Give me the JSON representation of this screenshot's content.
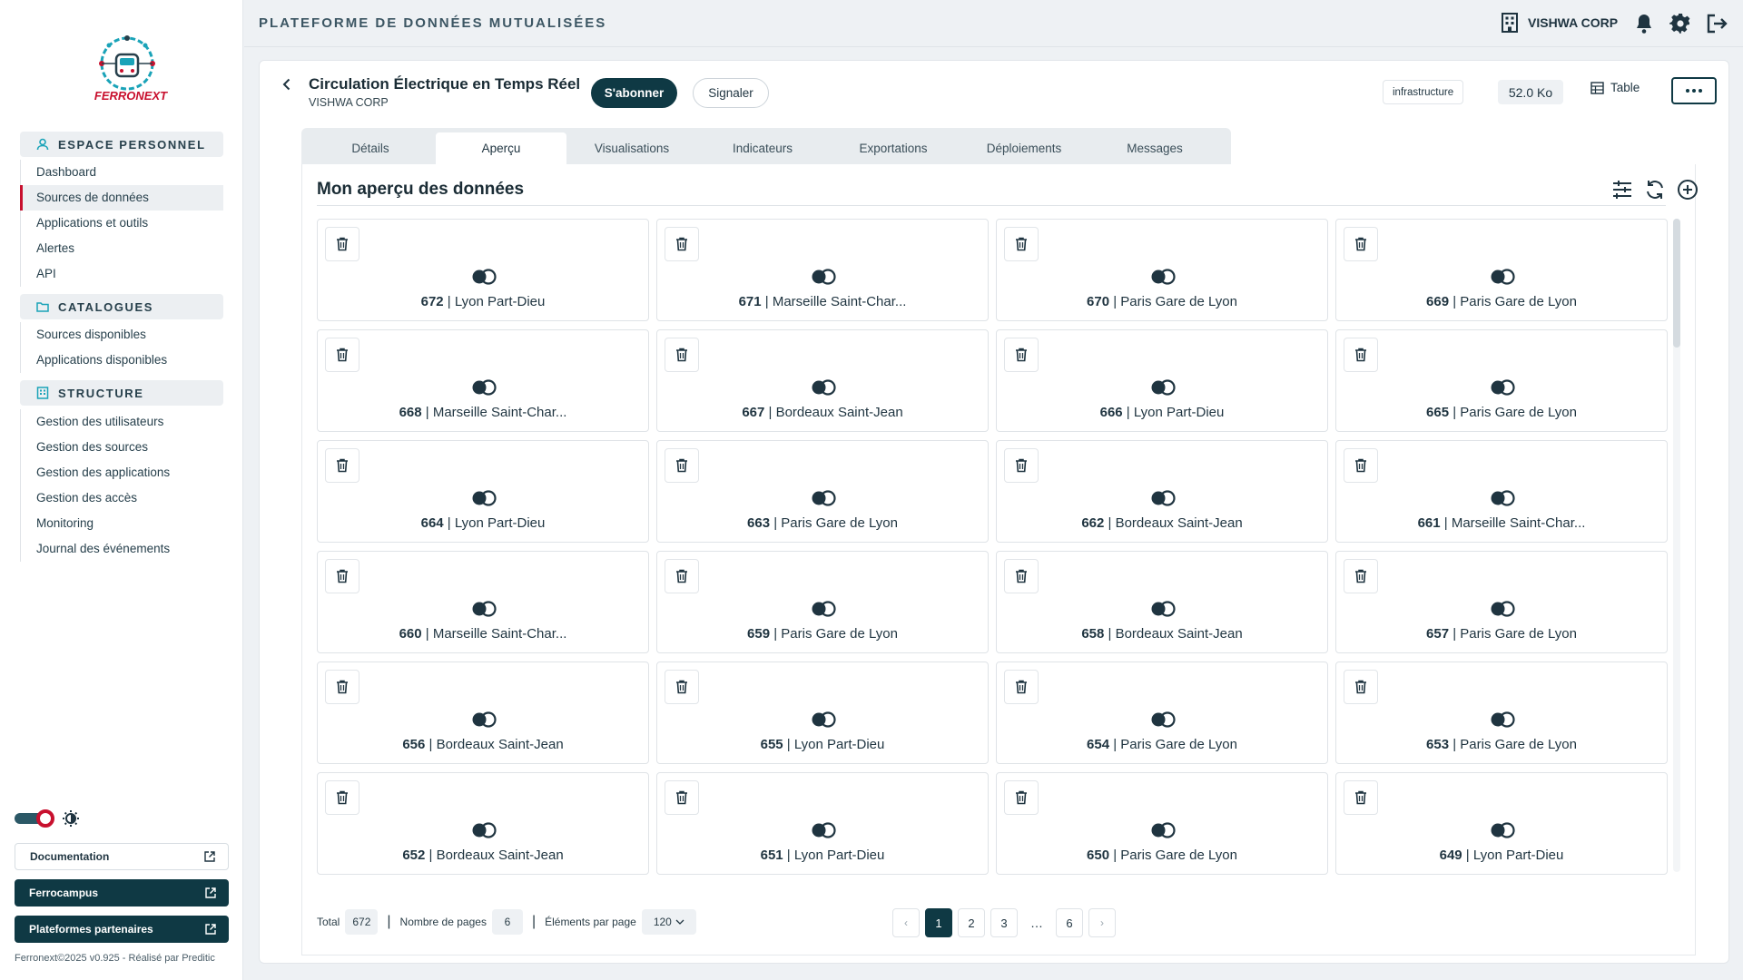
{
  "app": {
    "platform_title": "PLATEFORME DE DONNÉES MUTUALISÉES",
    "org_name": "VISHWA CORP",
    "logo_text": "FERRONEXT",
    "accent_color": "#c8102e",
    "primary_color": "#0f3944"
  },
  "sidebar": {
    "sections": [
      {
        "title": "ESPACE PERSONNEL",
        "icon": "user-icon",
        "items": [
          "Dashboard",
          "Sources de données",
          "Applications et outils",
          "Alertes",
          "API"
        ]
      },
      {
        "title": "CATALOGUES",
        "icon": "folder-icon",
        "items": [
          "Sources disponibles",
          "Applications disponibles"
        ]
      },
      {
        "title": "STRUCTURE",
        "icon": "building-icon",
        "items": [
          "Gestion des utilisateurs",
          "Gestion des sources",
          "Gestion des applications",
          "Gestion des accès",
          "Monitoring",
          "Journal des événements"
        ]
      }
    ],
    "active_item": "Sources de données",
    "buttons": {
      "documentation": "Documentation",
      "ferrocampus": "Ferrocampus",
      "partners": "Plateformes partenaires"
    },
    "footer": "Ferronext©2025 v0.925 - Réalisé par Preditic"
  },
  "dataset": {
    "title": "Circulation Électrique en Temps Réel",
    "org": "VISHWA CORP",
    "subscribe_label": "S'abonner",
    "report_label": "Signaler",
    "tag": "infrastructure",
    "size": "52.0 Ko",
    "view_label": "Table"
  },
  "tabs": [
    "Détails",
    "Aperçu",
    "Visualisations",
    "Indicateurs",
    "Exportations",
    "Déploiements",
    "Messages"
  ],
  "active_tab": "Aperçu",
  "preview": {
    "title": "Mon aperçu des données",
    "tiles": [
      {
        "id": "672",
        "name": "Lyon Part-Dieu"
      },
      {
        "id": "671",
        "name": "Marseille Saint-Char..."
      },
      {
        "id": "670",
        "name": "Paris Gare de Lyon"
      },
      {
        "id": "669",
        "name": "Paris Gare de Lyon"
      },
      {
        "id": "668",
        "name": "Marseille Saint-Char..."
      },
      {
        "id": "667",
        "name": "Bordeaux Saint-Jean"
      },
      {
        "id": "666",
        "name": "Lyon Part-Dieu"
      },
      {
        "id": "665",
        "name": "Paris Gare de Lyon"
      },
      {
        "id": "664",
        "name": "Lyon Part-Dieu"
      },
      {
        "id": "663",
        "name": "Paris Gare de Lyon"
      },
      {
        "id": "662",
        "name": "Bordeaux Saint-Jean"
      },
      {
        "id": "661",
        "name": "Marseille Saint-Char..."
      },
      {
        "id": "660",
        "name": "Marseille Saint-Char..."
      },
      {
        "id": "659",
        "name": "Paris Gare de Lyon"
      },
      {
        "id": "658",
        "name": "Bordeaux Saint-Jean"
      },
      {
        "id": "657",
        "name": "Paris Gare de Lyon"
      },
      {
        "id": "656",
        "name": "Bordeaux Saint-Jean"
      },
      {
        "id": "655",
        "name": "Lyon Part-Dieu"
      },
      {
        "id": "654",
        "name": "Paris Gare de Lyon"
      },
      {
        "id": "653",
        "name": "Paris Gare de Lyon"
      },
      {
        "id": "652",
        "name": "Bordeaux Saint-Jean"
      },
      {
        "id": "651",
        "name": "Lyon Part-Dieu"
      },
      {
        "id": "650",
        "name": "Paris Gare de Lyon"
      },
      {
        "id": "649",
        "name": "Lyon Part-Dieu"
      }
    ]
  },
  "pagination": {
    "total_label": "Total",
    "total": "672",
    "pages_label": "Nombre de pages",
    "pages": "6",
    "per_page_label": "Éléments par page",
    "per_page": "120",
    "prev": "‹",
    "next": "›",
    "page_buttons": [
      "1",
      "2",
      "3",
      "…",
      "6"
    ],
    "current_page": "1"
  }
}
